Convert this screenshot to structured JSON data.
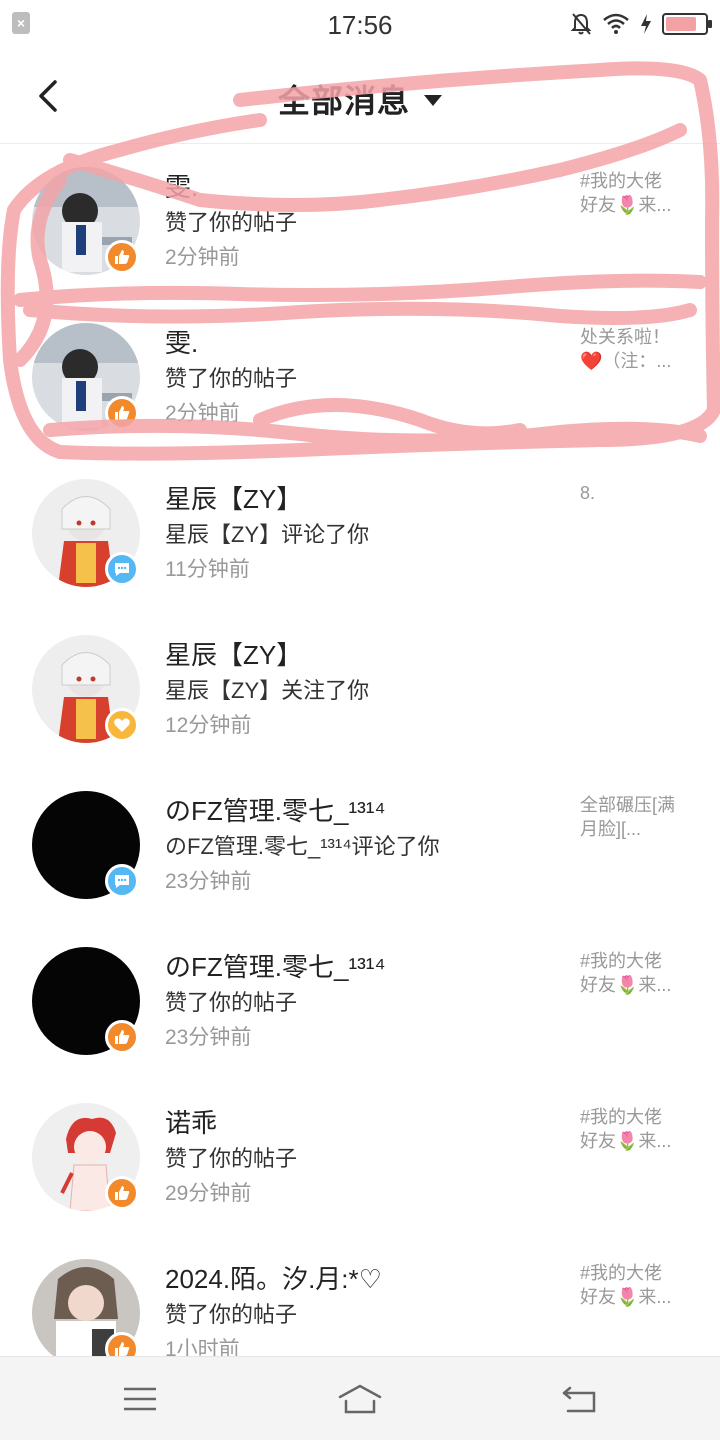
{
  "status": {
    "time": "17:56",
    "left_icon": "close-box-icon",
    "right_icons": [
      "mute-bell-icon",
      "wifi-icon",
      "charging-icon",
      "battery-icon"
    ],
    "battery_color": "#f3a1a5"
  },
  "header": {
    "title": "全部消息",
    "back_icon": "chevron-left-icon",
    "dropdown_icon": "caret-down-icon"
  },
  "colors": {
    "like_badge": "#f28a2b",
    "comment_badge": "#53b8f3",
    "follow_badge": "#f7b73a",
    "scribble": "#f4a4a8"
  },
  "messages": [
    {
      "name": "雯.",
      "action": "赞了你的帖子",
      "time": "2分钟前",
      "preview": "#我的大佬\n好友🌷来...",
      "badge": "like"
    },
    {
      "name": "雯.",
      "action": "赞了你的帖子",
      "time": "2分钟前",
      "preview": "处关系啦！\n❤️（注：...",
      "badge": "like"
    },
    {
      "name": "星辰【ZY】",
      "action": "星辰【ZY】评论了你",
      "time": "11分钟前",
      "preview": "8.",
      "badge": "comment"
    },
    {
      "name": "星辰【ZY】",
      "action": "星辰【ZY】关注了你",
      "time": "12分钟前",
      "preview": "",
      "badge": "follow"
    },
    {
      "name": "のFZ管理.零七_¹³¹⁴",
      "action": "のFZ管理.零七_¹³¹⁴评论了你",
      "time": "23分钟前",
      "preview": "全部碾压[满\n月脸][...",
      "badge": "comment"
    },
    {
      "name": "のFZ管理.零七_¹³¹⁴",
      "action": "赞了你的帖子",
      "time": "23分钟前",
      "preview": "#我的大佬\n好友🌷来...",
      "badge": "like"
    },
    {
      "name": "诺乖",
      "action": "赞了你的帖子",
      "time": "29分钟前",
      "preview": "#我的大佬\n好友🌷来...",
      "badge": "like"
    },
    {
      "name": "2024.陌。汐.月:*♡",
      "action": "赞了你的帖子",
      "time": "1小时前",
      "preview": "#我的大佬\n好友🌷来...",
      "badge": "like"
    }
  ],
  "nav": {
    "menu_icon": "menu-icon",
    "home_icon": "home-icon",
    "back_icon": "back-arrow-icon"
  }
}
